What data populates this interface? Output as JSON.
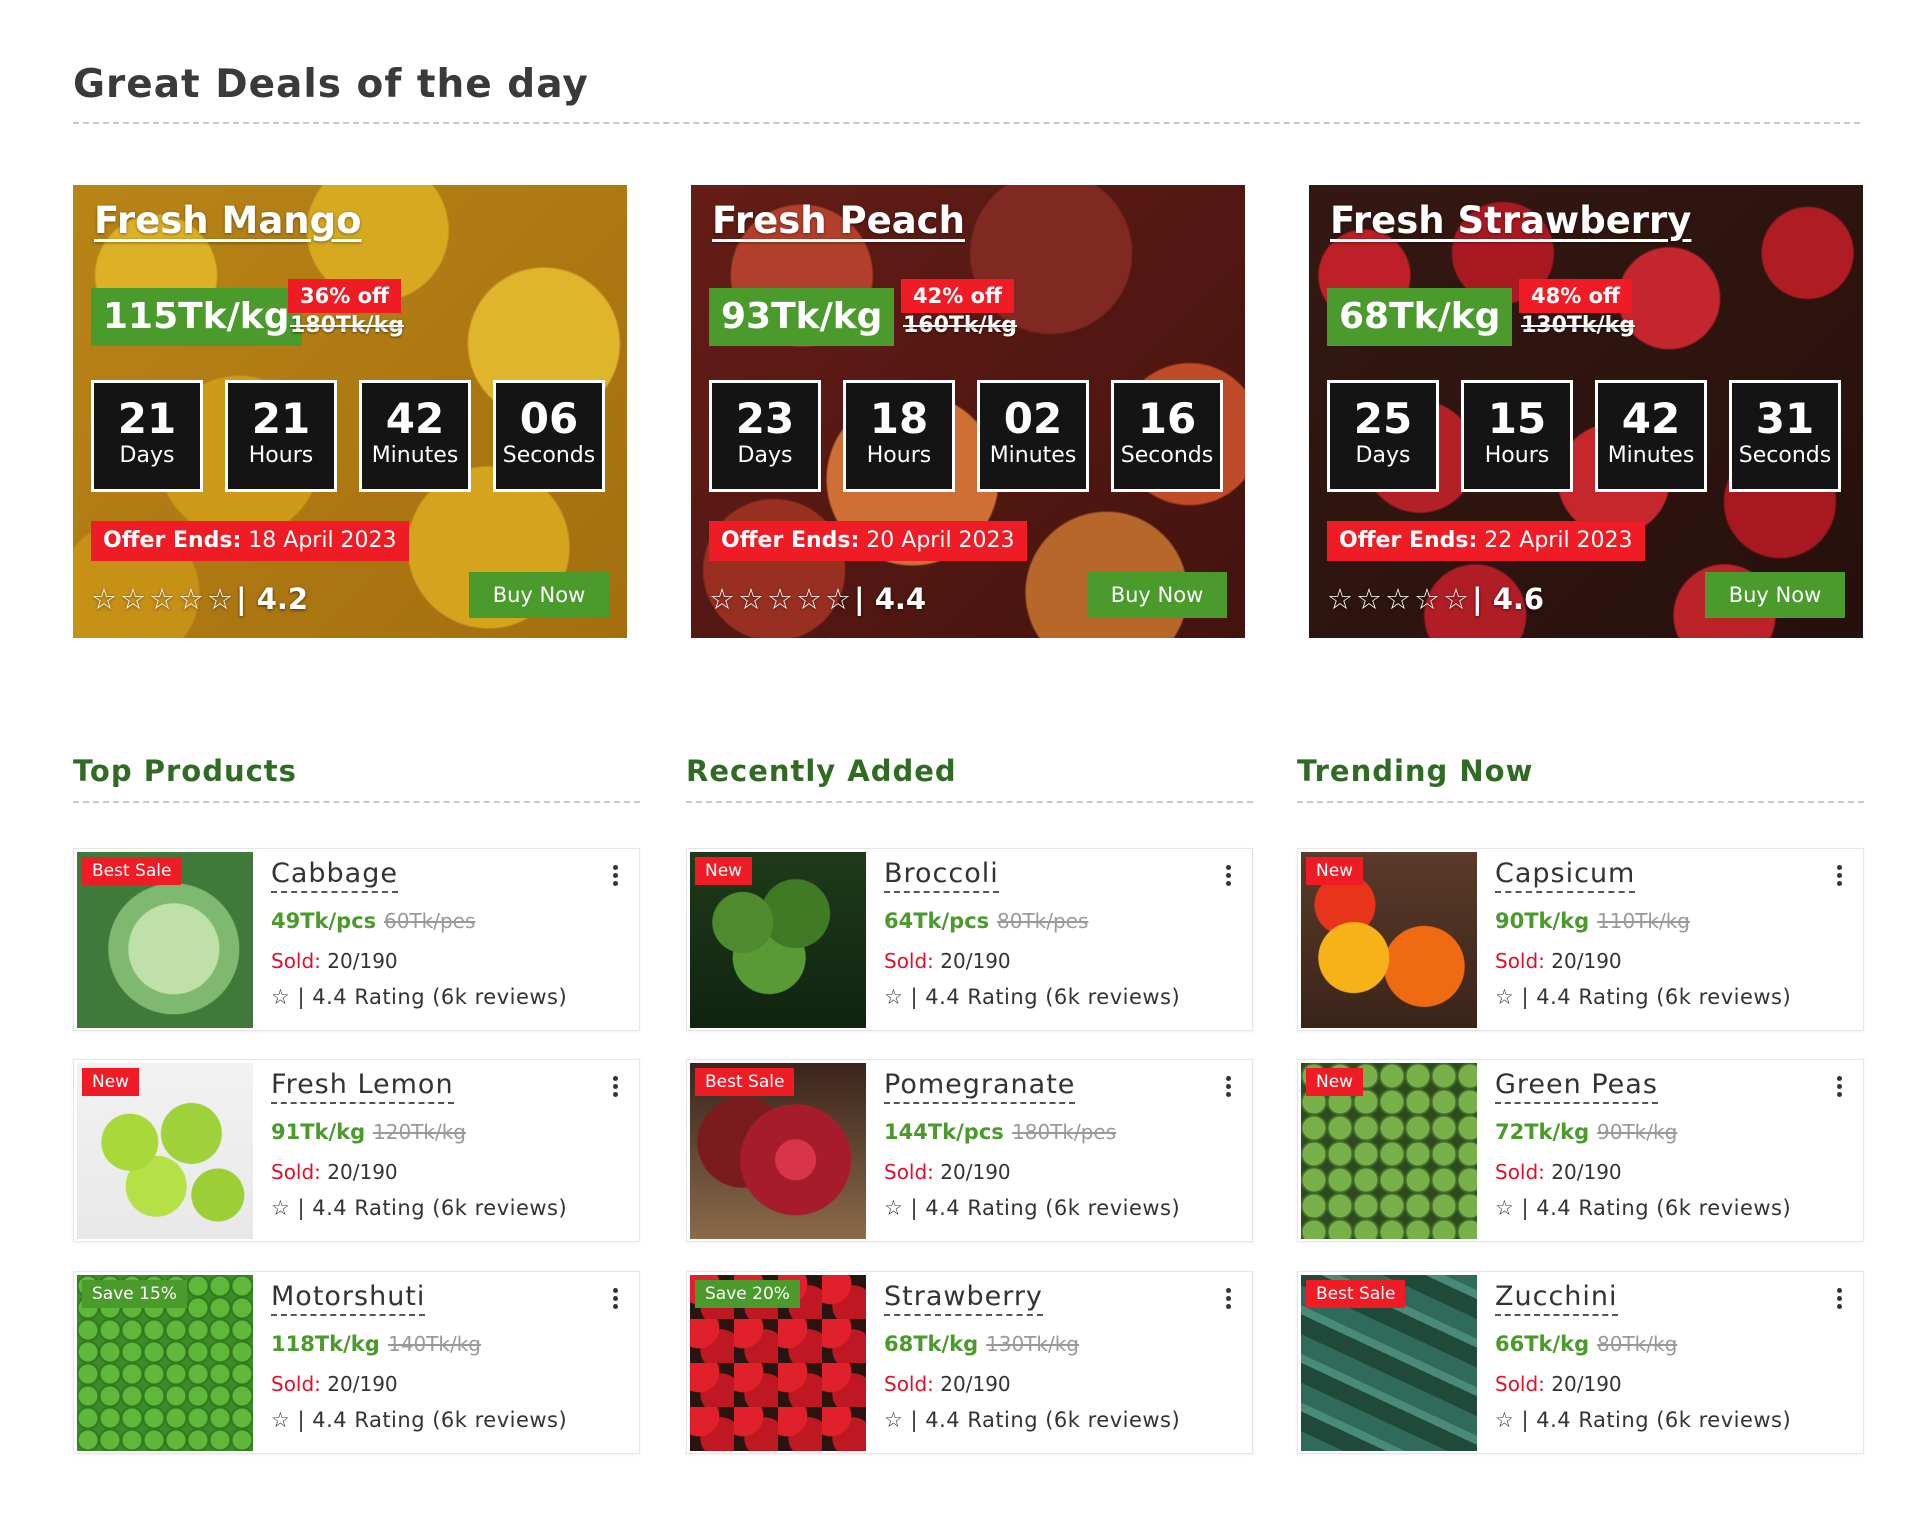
{
  "page": {
    "title": "Great Deals of the day"
  },
  "deals": [
    {
      "name": "Fresh Mango",
      "price": "115Tk/kg",
      "off": "36% off",
      "old_price": "180Tk/kg",
      "countdown": [
        {
          "value": "21",
          "label": "Days"
        },
        {
          "value": "21",
          "label": "Hours"
        },
        {
          "value": "42",
          "label": "Minutes"
        },
        {
          "value": "06",
          "label": "Seconds"
        }
      ],
      "ends_label": "Offer Ends:",
      "ends_date": "18 April 2023",
      "stars": "☆☆☆☆☆",
      "rating": "| 4.2",
      "buy_label": "Buy Now"
    },
    {
      "name": "Fresh Peach",
      "price": "93Tk/kg",
      "off": "42% off",
      "old_price": "160Tk/kg",
      "countdown": [
        {
          "value": "23",
          "label": "Days"
        },
        {
          "value": "18",
          "label": "Hours"
        },
        {
          "value": "02",
          "label": "Minutes"
        },
        {
          "value": "16",
          "label": "Seconds"
        }
      ],
      "ends_label": "Offer Ends:",
      "ends_date": "20 April 2023",
      "stars": "☆☆☆☆☆",
      "rating": "| 4.4",
      "buy_label": "Buy Now"
    },
    {
      "name": "Fresh Strawberry",
      "price": "68Tk/kg",
      "off": "48% off",
      "old_price": "130Tk/kg",
      "countdown": [
        {
          "value": "25",
          "label": "Days"
        },
        {
          "value": "15",
          "label": "Hours"
        },
        {
          "value": "42",
          "label": "Minutes"
        },
        {
          "value": "31",
          "label": "Seconds"
        }
      ],
      "ends_label": "Offer Ends:",
      "ends_date": "22 April 2023",
      "stars": "☆☆☆☆☆",
      "rating": "| 4.6",
      "buy_label": "Buy Now"
    }
  ],
  "sections": [
    {
      "title": "Top Products",
      "items": [
        {
          "badge": "Best Sale",
          "badge_color": "#ef1c25",
          "name": "Cabbage",
          "price": "49Tk/pcs",
          "old_price": "60Tk/pes",
          "sold_label": "Sold:",
          "sold": "20/190",
          "rating": "☆ | 4.4 Rating (6k reviews)"
        },
        {
          "badge": "New",
          "badge_color": "#ef1c25",
          "name": "Fresh Lemon",
          "price": "91Tk/kg",
          "old_price": "120Tk/kg",
          "sold_label": "Sold:",
          "sold": "20/190",
          "rating": "☆ | 4.4 Rating (6k reviews)"
        },
        {
          "badge": "Save 15%",
          "badge_color": "#4a9a2c",
          "name": "Motorshuti",
          "price": "118Tk/kg",
          "old_price": "140Tk/kg",
          "sold_label": "Sold:",
          "sold": "20/190",
          "rating": "☆ | 4.4 Rating (6k reviews)"
        }
      ]
    },
    {
      "title": "Recently Added",
      "items": [
        {
          "badge": "New",
          "badge_color": "#ef1c25",
          "name": "Broccoli",
          "price": "64Tk/pcs",
          "old_price": "80Tk/pes",
          "sold_label": "Sold:",
          "sold": "20/190",
          "rating": "☆ | 4.4 Rating (6k reviews)"
        },
        {
          "badge": "Best Sale",
          "badge_color": "#ef1c25",
          "name": "Pomegranate",
          "price": "144Tk/pcs",
          "old_price": "180Tk/pes",
          "sold_label": "Sold:",
          "sold": "20/190",
          "rating": "☆ | 4.4 Rating (6k reviews)"
        },
        {
          "badge": "Save 20%",
          "badge_color": "#4a9a2c",
          "name": "Strawberry",
          "price": "68Tk/kg",
          "old_price": "130Tk/kg",
          "sold_label": "Sold:",
          "sold": "20/190",
          "rating": "☆ | 4.4 Rating (6k reviews)"
        }
      ]
    },
    {
      "title": "Trending Now",
      "items": [
        {
          "badge": "New",
          "badge_color": "#ef1c25",
          "name": "Capsicum",
          "price": "90Tk/kg",
          "old_price": "110Tk/kg",
          "sold_label": "Sold:",
          "sold": "20/190",
          "rating": "☆ | 4.4 Rating (6k reviews)"
        },
        {
          "badge": "New",
          "badge_color": "#ef1c25",
          "name": "Green Peas",
          "price": "72Tk/kg",
          "old_price": "90Tk/kg",
          "sold_label": "Sold:",
          "sold": "20/190",
          "rating": "☆ | 4.4 Rating (6k reviews)"
        },
        {
          "badge": "Best Sale",
          "badge_color": "#ef1c25",
          "name": "Zucchini",
          "price": "66Tk/kg",
          "old_price": "80Tk/kg",
          "sold_label": "Sold:",
          "sold": "20/190",
          "rating": "☆ | 4.4 Rating (6k reviews)"
        }
      ]
    }
  ]
}
